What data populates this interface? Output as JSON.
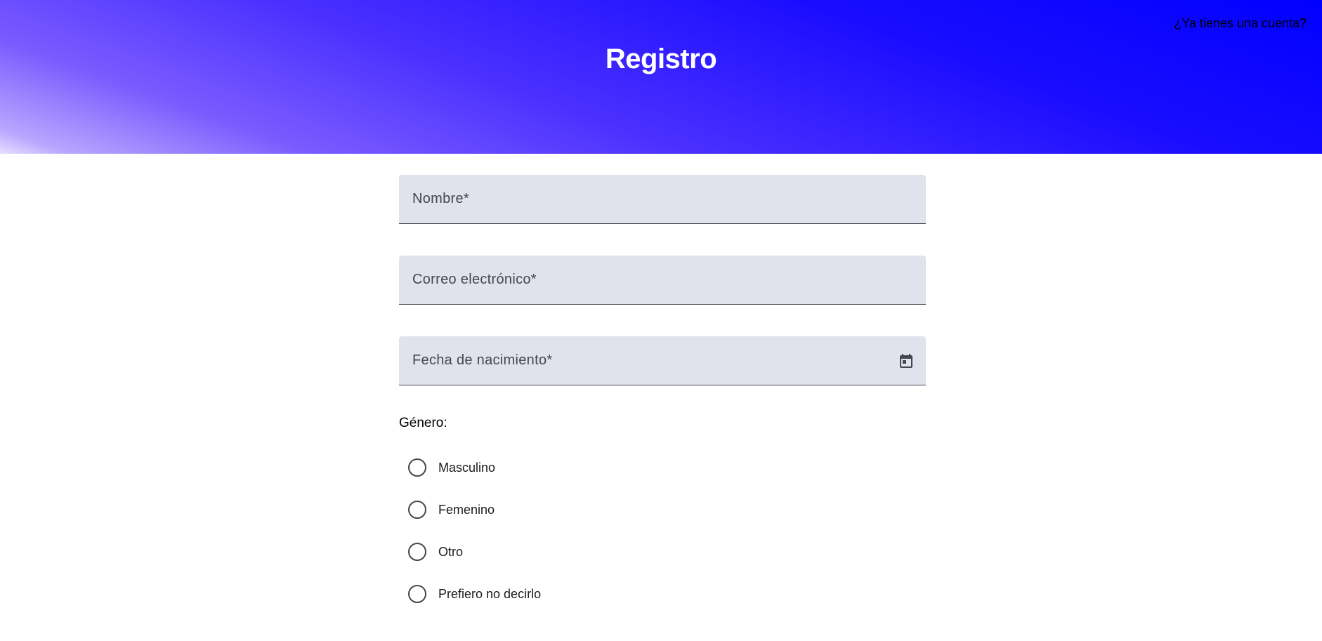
{
  "header": {
    "title": "Registro",
    "login_link": "¿Ya tienes una cuenta?"
  },
  "form": {
    "fields": [
      {
        "label": "Nombre*",
        "value": ""
      },
      {
        "label": "Correo electrónico*",
        "value": ""
      },
      {
        "label": "Fecha de nacimiento*",
        "value": "",
        "icon": "calendar-icon"
      }
    ],
    "gender": {
      "label": "Género:",
      "options": [
        "Masculino",
        "Femenino",
        "Otro",
        "Prefiero no decirlo"
      ],
      "selected": null
    }
  },
  "colors": {
    "header_gradient_start": "#0000ff",
    "header_gradient_end": "#e6e0ff",
    "field_background": "#e0e2ec",
    "field_underline": "#44474e"
  }
}
